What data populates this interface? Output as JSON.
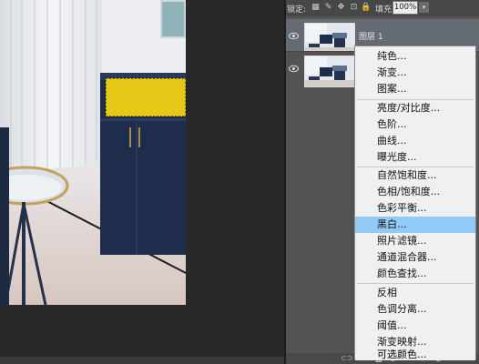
{
  "layers_panel": {
    "lock_label": "锁定:",
    "fill_label": "填充:",
    "fill_value": "100%",
    "layers": [
      {
        "name": "图层 1",
        "selected": true,
        "visible": true
      },
      {
        "name": "",
        "selected": false,
        "visible": true
      }
    ]
  },
  "context_menu": {
    "items": [
      "纯色...",
      "渐变...",
      "图案...",
      "亮度/对比度...",
      "色阶...",
      "曲线...",
      "曝光度...",
      "自然饱和度...",
      "色相/饱和度...",
      "色彩平衡...",
      "黑白...",
      "照片滤镜...",
      "通道混合器...",
      "颜色查找...",
      "反相",
      "色调分离...",
      "阈值...",
      "渐变映射...",
      "可选颜色..."
    ],
    "highlighted": "黑白..."
  },
  "colors": {
    "panel_bg": "#535353",
    "selected_layer": "#656b73",
    "menu_highlight": "#91c9f7",
    "canvas_bg": "#282828",
    "cabinet_navy": "#1f2d4c",
    "selection_yellow": "#e6c918"
  },
  "icons": [
    "eye-icon",
    "lock-transparent-icon",
    "lock-brush-icon",
    "lock-move-icon",
    "lock-artboard-icon",
    "lock-all-icon",
    "chevron-down-icon",
    "link-icon",
    "fx-icon",
    "mask-icon",
    "adjustment-icon",
    "folder-icon",
    "new-layer-icon",
    "trash-icon"
  ]
}
